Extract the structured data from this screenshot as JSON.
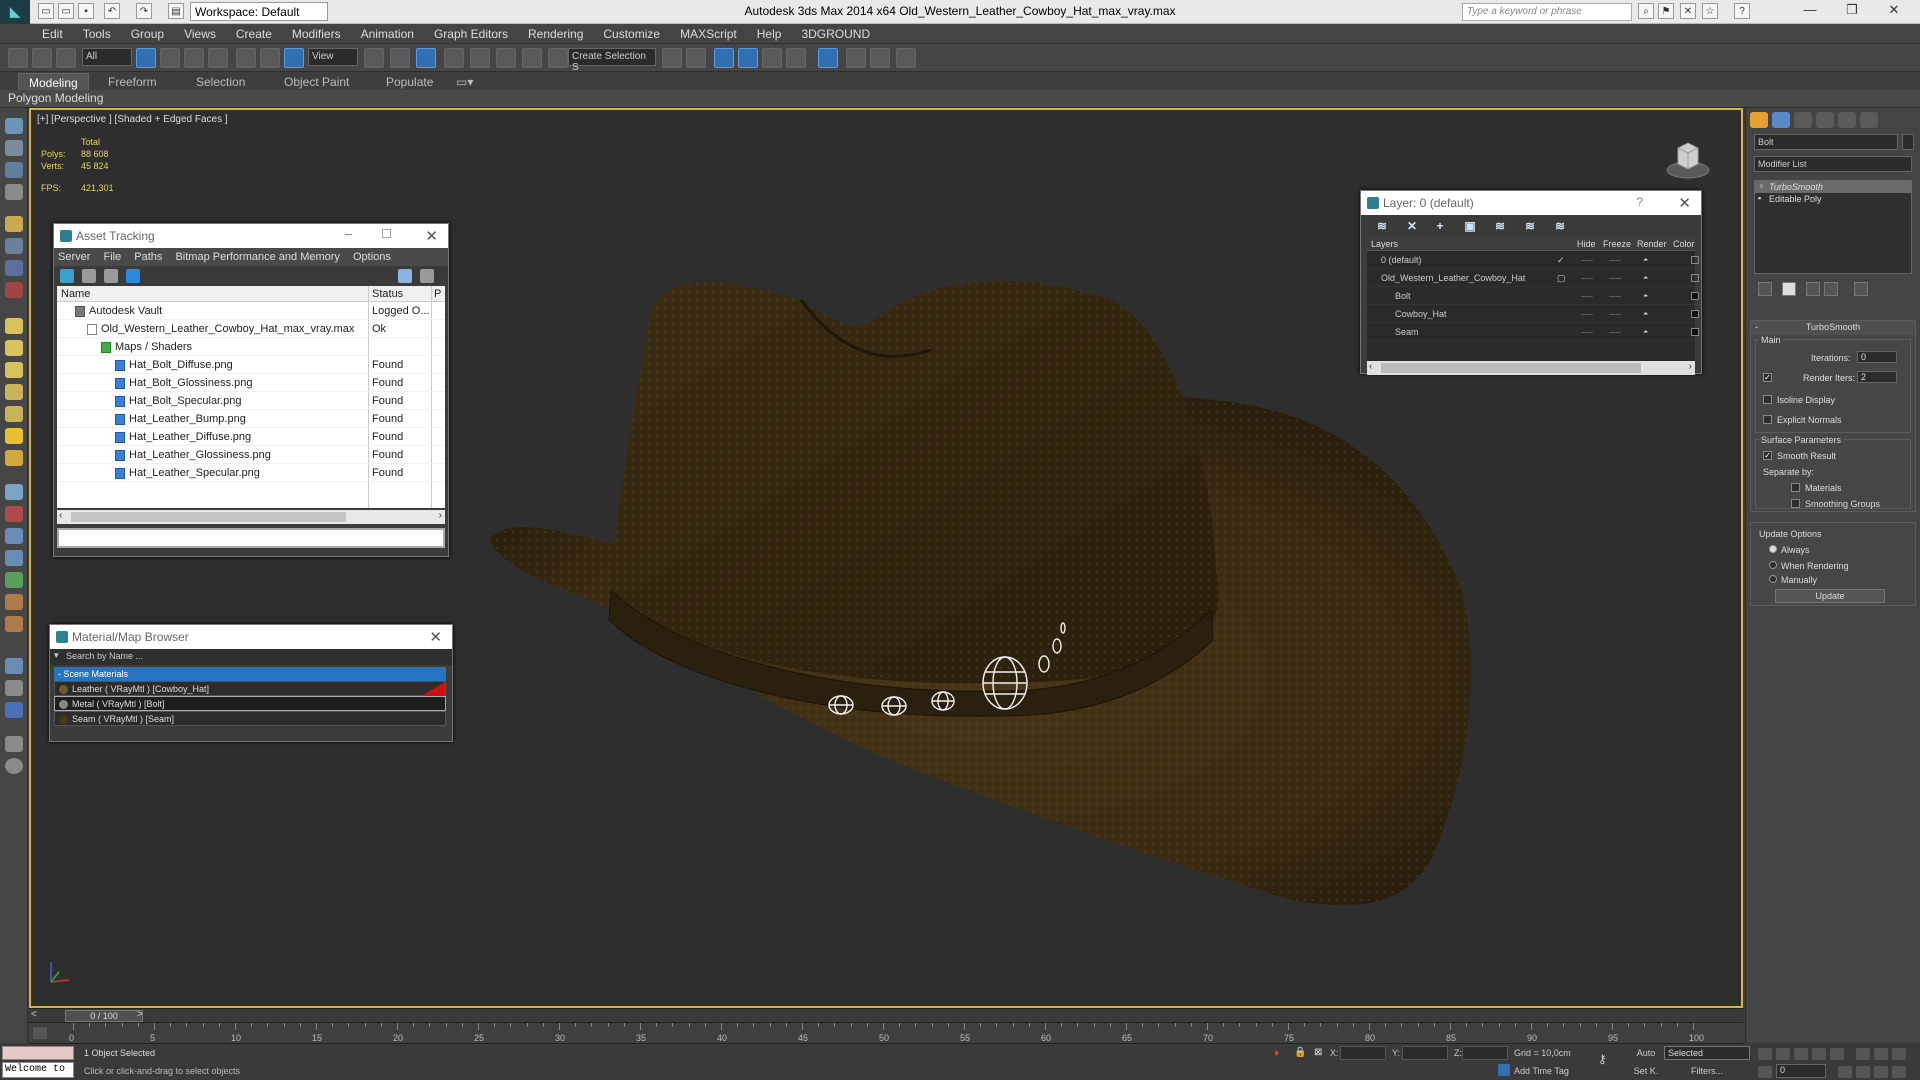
{
  "titlebar": {
    "workspace": "Workspace: Default",
    "app_title": "Autodesk 3ds Max  2014 x64     Old_Western_Leather_Cowboy_Hat_max_vray.max",
    "search_placeholder": "Type a keyword or phrase"
  },
  "menu": [
    "Edit",
    "Tools",
    "Group",
    "Views",
    "Create",
    "Modifiers",
    "Animation",
    "Graph Editors",
    "Rendering",
    "Customize",
    "MAXScript",
    "Help",
    "3DGROUND"
  ],
  "toolbar": {
    "filter_all": "All",
    "ref_coord": "View",
    "named_selection": "Create Selection S"
  },
  "ribbon": {
    "tabs": [
      "Modeling",
      "Freeform",
      "Selection",
      "Object Paint",
      "Populate"
    ],
    "active_tab": "Modeling",
    "panel_label": "Polygon Modeling"
  },
  "viewport": {
    "label": "[+] [Perspective ] [Shaded + Edged Faces ]",
    "stats_total_label": "Total",
    "polys_label": "Polys:",
    "polys_value": "88 608",
    "verts_label": "Verts:",
    "verts_value": "45 824",
    "fps_label": "FPS:",
    "fps_value": "421,301"
  },
  "asset_tracking": {
    "title": "Asset Tracking",
    "menu": [
      "Server",
      "File",
      "Paths",
      "Bitmap Performance and Memory",
      "Options"
    ],
    "columns": [
      "Name",
      "Status",
      "P"
    ],
    "rows": [
      {
        "name": "Autodesk Vault",
        "status": "Logged O..."
      },
      {
        "name": "Old_Western_Leather_Cowboy_Hat_max_vray.max",
        "status": "Ok"
      },
      {
        "name": "Maps / Shaders",
        "status": ""
      },
      {
        "name": "Hat_Bolt_Diffuse.png",
        "status": "Found"
      },
      {
        "name": "Hat_Bolt_Glossiness.png",
        "status": "Found"
      },
      {
        "name": "Hat_Bolt_Specular.png",
        "status": "Found"
      },
      {
        "name": "Hat_Leather_Bump.png",
        "status": "Found"
      },
      {
        "name": "Hat_Leather_Diffuse.png",
        "status": "Found"
      },
      {
        "name": "Hat_Leather_Glossiness.png",
        "status": "Found"
      },
      {
        "name": "Hat_Leather_Specular.png",
        "status": "Found"
      }
    ]
  },
  "material_browser": {
    "title": "Material/Map Browser",
    "search_placeholder": "Search by Name ...",
    "group": "- Scene Materials",
    "items": [
      "Leather ( VRayMtl ) [Cowboy_Hat]",
      "Metal ( VRayMtl ) [Bolt]",
      "Seam ( VRayMtl ) [Seam]"
    ]
  },
  "layers": {
    "title": "Layer: 0 (default)",
    "columns": [
      "Layers",
      "Hide",
      "Freeze",
      "Render",
      "Color"
    ],
    "rows": [
      "0 (default)",
      "Old_Western_Leather_Cowboy_Hat",
      "Bolt",
      "Cowboy_Hat",
      "Seam"
    ]
  },
  "command_panel": {
    "object_name": "Bolt",
    "modifier_list": "Modifier List",
    "stack": [
      "TurboSmooth",
      "Editable Poly"
    ],
    "turbosmooth": {
      "title": "TurboSmooth",
      "main": "Main",
      "iterations_label": "Iterations:",
      "iterations": "0",
      "render_iters_label": "Render Iters:",
      "render_iters": "2",
      "isoline": "Isoline Display",
      "explicit_normals": "Explicit Normals",
      "surface_params": "Surface Parameters",
      "smooth_result": "Smooth Result",
      "separate_by": "Separate by:",
      "materials": "Materials",
      "smoothing_groups": "Smoothing Groups",
      "update_options": "Update Options",
      "always": "Always",
      "when_rendering": "When Rendering",
      "manually": "Manually",
      "update_btn": "Update"
    }
  },
  "timeline": {
    "position": "0 / 100",
    "ticks": [
      "0",
      "5",
      "10",
      "15",
      "20",
      "25",
      "30",
      "35",
      "40",
      "45",
      "50",
      "55",
      "60",
      "65",
      "70",
      "75",
      "80",
      "85",
      "90",
      "95",
      "100"
    ]
  },
  "status": {
    "welcome": "Welcome to",
    "selected": "1 Object Selected",
    "prompt": "Click or click-and-drag to select objects",
    "x_label": "X:",
    "y_label": "Y:",
    "z_label": "Z:",
    "grid": "Grid = 10,0cm",
    "add_time_tag": "Add Time Tag",
    "auto": "Auto",
    "set_k": "Set K.",
    "selected_dd": "Selected",
    "filters": "Filters...",
    "frame": "0"
  },
  "colors": {
    "viewport_border": "#d3b34a",
    "selection_blue": "#2673c2",
    "stats_yellow": "#e7d36a"
  }
}
